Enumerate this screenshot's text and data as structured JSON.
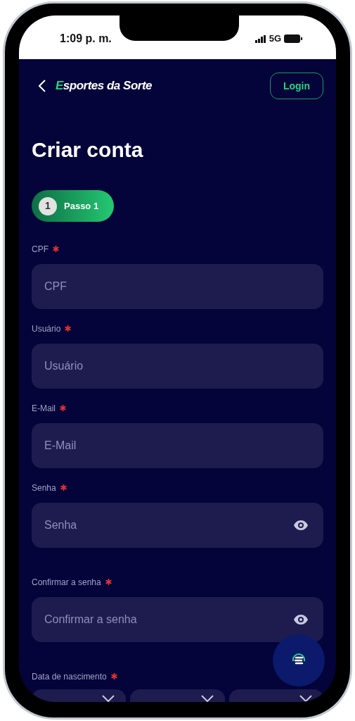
{
  "status_bar": {
    "time": "1:09 p. m.",
    "network": "5G"
  },
  "header": {
    "logo": "Esportes da Sorte",
    "login_button": "Login"
  },
  "title": "Criar conta",
  "steps": [
    {
      "number": "1",
      "label": "Passo 1",
      "selected": true
    }
  ],
  "fields": [
    {
      "kind": "text",
      "label": "CPF",
      "required": true,
      "placeholder": "CPF"
    },
    {
      "kind": "text",
      "label": "Usuário",
      "required": true,
      "placeholder": "Usuário"
    },
    {
      "kind": "text",
      "label": "E-Mail",
      "required": true,
      "placeholder": "E-Mail"
    },
    {
      "kind": "password",
      "label": "Senha",
      "required": true,
      "placeholder": "Senha"
    },
    {
      "kind": "password",
      "label": "Confirmar a senha",
      "required": true,
      "placeholder": "Confirmar a senha"
    },
    {
      "kind": "date",
      "label": "Data de nascimento",
      "required": true,
      "parts": [
        {
          "kind": "dropdown"
        },
        {
          "kind": "dropdown"
        },
        {
          "kind": "dropdown"
        }
      ]
    }
  ]
}
